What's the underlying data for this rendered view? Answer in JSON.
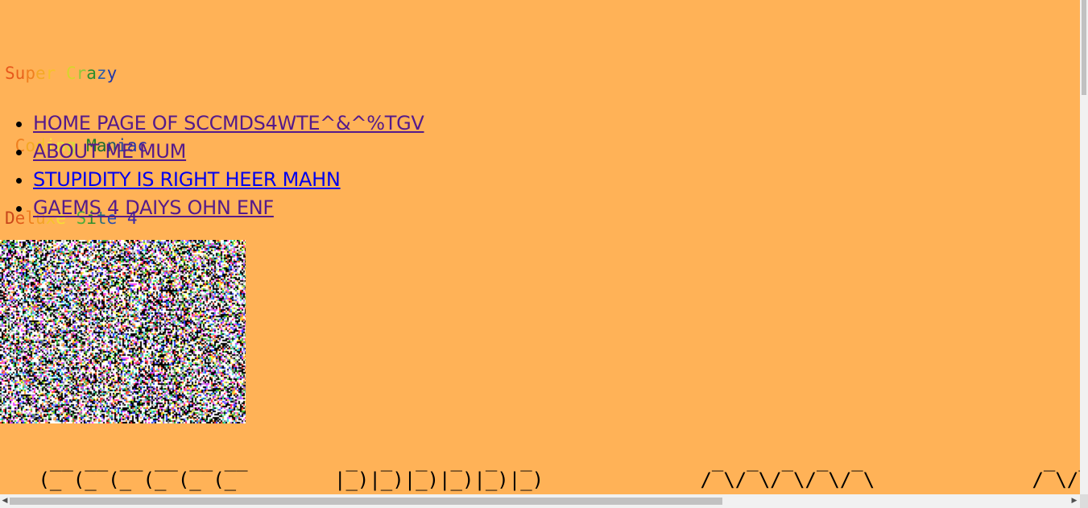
{
  "site_title": {
    "lines": [
      {
        "chars": [
          {
            "ch": "S",
            "color": "#e8571b"
          },
          {
            "ch": "u",
            "color": "#e8611b"
          },
          {
            "ch": "p",
            "color": "#ef7f1f"
          },
          {
            "ch": "e",
            "color": "#f4a824"
          },
          {
            "ch": "r",
            "color": "#f6c22a"
          },
          {
            "ch": " ",
            "color": "#f6c22a"
          },
          {
            "ch": "C",
            "color": "#d7d52c"
          },
          {
            "ch": "r",
            "color": "#91c83a"
          },
          {
            "ch": "a",
            "color": "#2e8f2e"
          },
          {
            "ch": "z",
            "color": "#2a5dab"
          },
          {
            "ch": "y",
            "color": "#2138a8"
          }
        ]
      },
      {
        "chars": [
          {
            "ch": " ",
            "color": "#e8611b"
          },
          {
            "ch": "C",
            "color": "#ef7f1f"
          },
          {
            "ch": "o",
            "color": "#f4a824"
          },
          {
            "ch": "d",
            "color": "#f6c22a"
          },
          {
            "ch": "i",
            "color": "#f9e53a"
          },
          {
            "ch": "n",
            "color": "#e3e73a"
          },
          {
            "ch": "g",
            "color": "#cfe03b"
          },
          {
            "ch": " ",
            "color": "#4fa23a"
          },
          {
            "ch": "M",
            "color": "#1e7a2a"
          },
          {
            "ch": "a",
            "color": "#1e6d30"
          },
          {
            "ch": "n",
            "color": "#1f5a6a"
          },
          {
            "ch": "i",
            "color": "#22449c"
          },
          {
            "ch": "a",
            "color": "#2233a8"
          },
          {
            "ch": "c",
            "color": "#2a2aa8"
          }
        ]
      },
      {
        "chars": [
          {
            "ch": "D",
            "color": "#c8461a"
          },
          {
            "ch": "e",
            "color": "#e15b1b"
          },
          {
            "ch": "l",
            "color": "#ef7f1f"
          },
          {
            "ch": "u",
            "color": "#f3a126"
          },
          {
            "ch": "x",
            "color": "#f6c22a"
          },
          {
            "ch": "e",
            "color": "#f7dc34"
          },
          {
            "ch": " ",
            "color": "#e4e53a"
          },
          {
            "ch": "S",
            "color": "#4fab3a"
          },
          {
            "ch": "i",
            "color": "#2e8f2e"
          },
          {
            "ch": "t",
            "color": "#2a6e7e"
          },
          {
            "ch": "e",
            "color": "#2a4db1"
          },
          {
            "ch": " ",
            "color": "#2a3eb0"
          },
          {
            "ch": "4",
            "color": "#3a2aa8"
          }
        ]
      }
    ]
  },
  "nav": {
    "items": [
      {
        "label": "HOME PAGE OF SCCMDS4WTE^&^%TGV",
        "visited": true
      },
      {
        "label": "ABOUT ME MUM",
        "visited": true
      },
      {
        "label": "STUPIDITY IS RIGHT HEER MAHN",
        "visited": false
      },
      {
        "label": "GAEMS 4 DAIYS OHN ENF",
        "visited": true
      }
    ]
  },
  "ascii_art": {
    "blocks": [
      {
        "line1": "  __ __ __ __ __ __",
        "line2": " (_ (_ (_ (_ (_ (_"
      },
      {
        "line1": " _  _  _  _  _  _",
        "line2": "|_)|_)|_)|_)|_)|_)"
      },
      {
        "line1": "  _  _  _  _  _",
        "line2": " / \\/ \\/ \\/ \\/ \\"
      },
      {
        "line1": "  _  _",
        "line2": " / \\/ \\"
      }
    ]
  },
  "colors": {
    "background": "#ffb257",
    "link_visited": "#551a8b",
    "link_unvisited": "#0000ee"
  }
}
